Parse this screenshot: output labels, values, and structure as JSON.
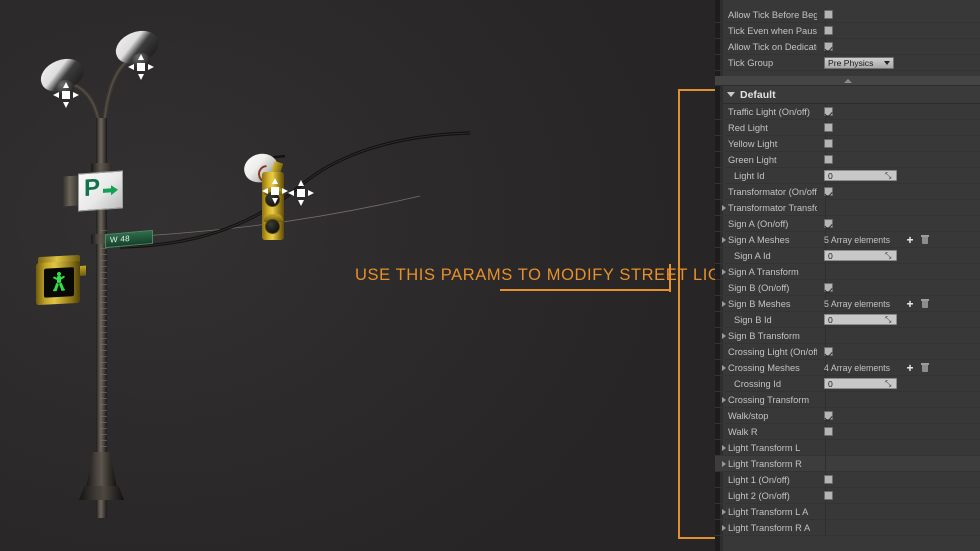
{
  "annotation": {
    "text": "USE THIS PARAMS TO MODIFY STREET LIGHT",
    "color": "#e8902a"
  },
  "viewport": {
    "background_color": "#2d2b2b",
    "objects": {
      "street_lamp": "street-lamp-pole",
      "parking_sign_letter": "P",
      "street_name_sign_text": "W 48",
      "traffic_light": "hanging-traffic-light",
      "pedestrian_signal": "walk-signal-green"
    }
  },
  "details_panel": {
    "sections": [
      {
        "name": "",
        "rows": [
          {
            "label": "Allow Tick Before Begin Pl",
            "type": "checkbox",
            "value": false,
            "clipped": true
          },
          {
            "label": "Tick Even when Paused",
            "type": "checkbox",
            "value": false
          },
          {
            "label": "Allow Tick on Dedicated Se",
            "type": "checkbox",
            "value": true
          },
          {
            "label": "Tick Group",
            "type": "dropdown",
            "value": "Pre Physics"
          }
        ]
      },
      {
        "name": "Default",
        "rows": [
          {
            "label": "Traffic Light (On/off)",
            "type": "checkbox",
            "value": true
          },
          {
            "label": "Red Light",
            "type": "checkbox",
            "value": false
          },
          {
            "label": "Yellow Light",
            "type": "checkbox",
            "value": false
          },
          {
            "label": "Green Light",
            "type": "checkbox",
            "value": false
          },
          {
            "label": "Light Id",
            "type": "number",
            "value": "0"
          },
          {
            "label": "Transformator (On/off)",
            "type": "checkbox",
            "value": true
          },
          {
            "label": "Transformator Transform",
            "type": "expandable"
          },
          {
            "label": "Sign A (On/off)",
            "type": "checkbox",
            "value": true
          },
          {
            "label": "Sign A Meshes",
            "type": "array",
            "value": "5 Array elements"
          },
          {
            "label": "Sign A Id",
            "type": "number",
            "value": "0"
          },
          {
            "label": "Sign A Transform",
            "type": "expandable"
          },
          {
            "label": "Sign B (On/off)",
            "type": "checkbox",
            "value": true
          },
          {
            "label": "Sign B Meshes",
            "type": "array",
            "value": "5 Array elements"
          },
          {
            "label": "Sign B Id",
            "type": "number",
            "value": "0"
          },
          {
            "label": "Sign B Transform",
            "type": "expandable"
          },
          {
            "label": "Crossing Light (On/off)",
            "type": "checkbox",
            "value": true
          },
          {
            "label": "Crossing Meshes",
            "type": "array",
            "value": "4 Array elements"
          },
          {
            "label": "Crossing Id",
            "type": "number",
            "value": "0"
          },
          {
            "label": "Crossing Transform",
            "type": "expandable"
          },
          {
            "label": "Walk/stop",
            "type": "checkbox",
            "value": true
          },
          {
            "label": "Walk R",
            "type": "checkbox",
            "value": false
          },
          {
            "label": "Light Transform L",
            "type": "expandable"
          },
          {
            "label": "Light Transform R",
            "type": "expandable",
            "highlight": true
          },
          {
            "label": "Light 1 (On/off)",
            "type": "checkbox",
            "value": false
          },
          {
            "label": "Light 2 (On/off)",
            "type": "checkbox",
            "value": false
          },
          {
            "label": "Light Transform L A",
            "type": "expandable"
          },
          {
            "label": "Light Transform R A",
            "type": "expandable"
          }
        ]
      }
    ]
  }
}
